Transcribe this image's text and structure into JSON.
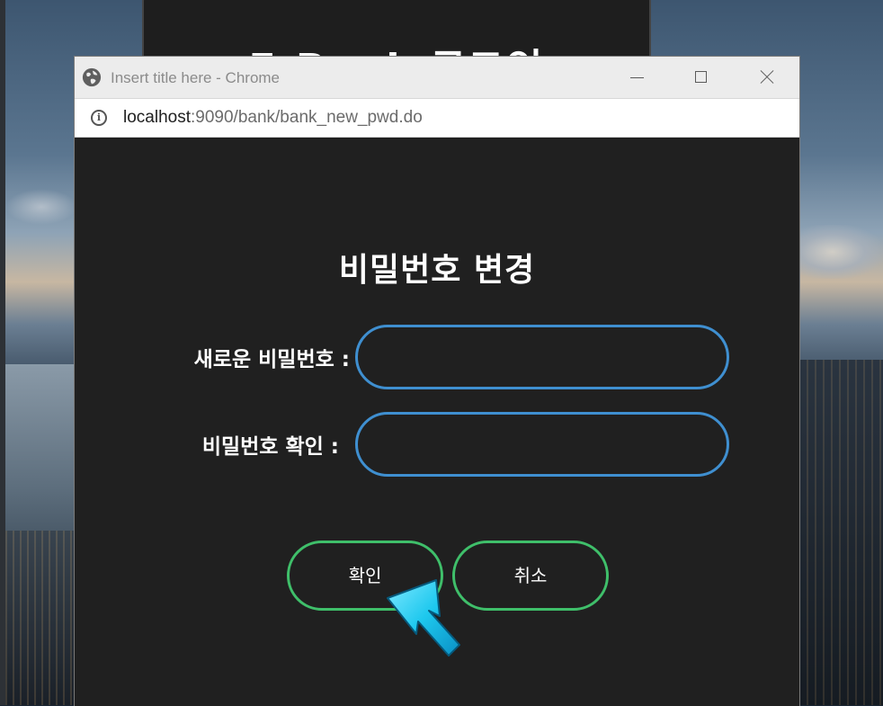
{
  "background_panel": {
    "title": "E-Bank 로그인"
  },
  "window": {
    "title": "Insert title here - Chrome",
    "icons": {
      "site": "globe-icon",
      "info": "info-icon",
      "minimize": "minimize-icon",
      "maximize": "maximize-icon",
      "close": "close-icon"
    }
  },
  "address_bar": {
    "host": "localhost",
    "path": ":9090/bank/bank_new_pwd.do"
  },
  "form": {
    "title": "비밀번호 변경",
    "new_password_label": "새로운 비밀번호 :",
    "new_password_value": "",
    "confirm_password_label": "비밀번호 확인 :",
    "confirm_password_value": "",
    "ok_button": "확인",
    "cancel_button": "취소"
  },
  "colors": {
    "input_border": "#3f8fd0",
    "button_border": "#3fbf6a",
    "panel_bg": "#202020",
    "cursor": "#1ec8ee"
  }
}
